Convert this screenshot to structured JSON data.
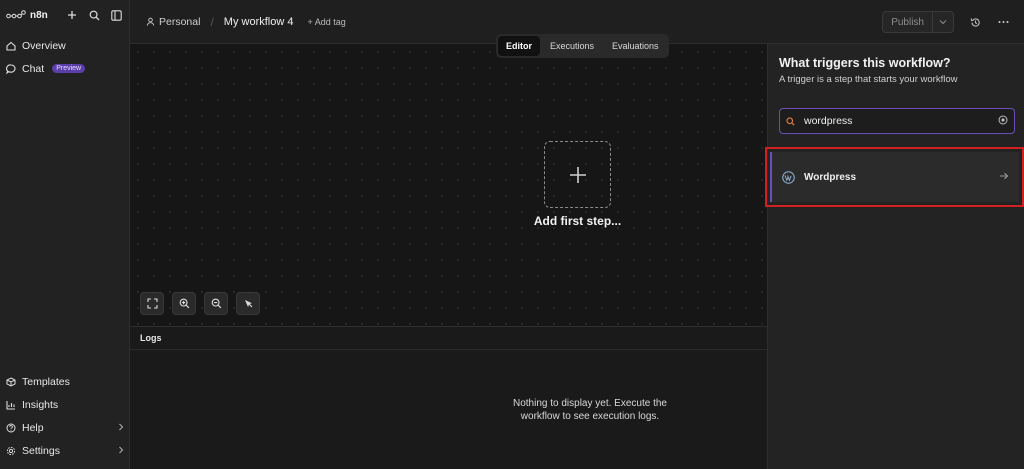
{
  "app": {
    "name": "n8n"
  },
  "sidebar": {
    "items": [
      {
        "label": "Overview",
        "icon": "home-icon"
      },
      {
        "label": "Chat",
        "badge": "Preview",
        "icon": "chat-bubble-icon"
      }
    ],
    "bottom_items": [
      {
        "label": "Templates",
        "icon": "box-icon"
      },
      {
        "label": "Insights",
        "icon": "bar-chart-icon"
      },
      {
        "label": "Help",
        "icon": "question-icon"
      },
      {
        "label": "Settings",
        "icon": "gear-icon"
      }
    ]
  },
  "header": {
    "project": "Personal",
    "workflow_name": "My workflow 4",
    "add_tag": "+ Add tag",
    "publish": "Publish"
  },
  "canvas": {
    "tabs": [
      {
        "label": "Editor",
        "active": true
      },
      {
        "label": "Executions",
        "active": false
      },
      {
        "label": "Evaluations",
        "active": false
      }
    ],
    "add_first_step": "Add first step..."
  },
  "logs": {
    "title": "Logs",
    "empty_line1": "Nothing to display yet. Execute the",
    "empty_line2": "workflow to see execution logs."
  },
  "trigger_panel": {
    "title": "What triggers this workflow?",
    "subtitle": "A trigger is a step that starts your workflow",
    "search_value": "wordpress",
    "results": [
      {
        "label": "Wordpress",
        "icon": "wordpress-icon"
      }
    ]
  },
  "colors": {
    "accent": "#6b4fb8",
    "highlight": "#d12020",
    "search_icon": "#e07b39"
  }
}
